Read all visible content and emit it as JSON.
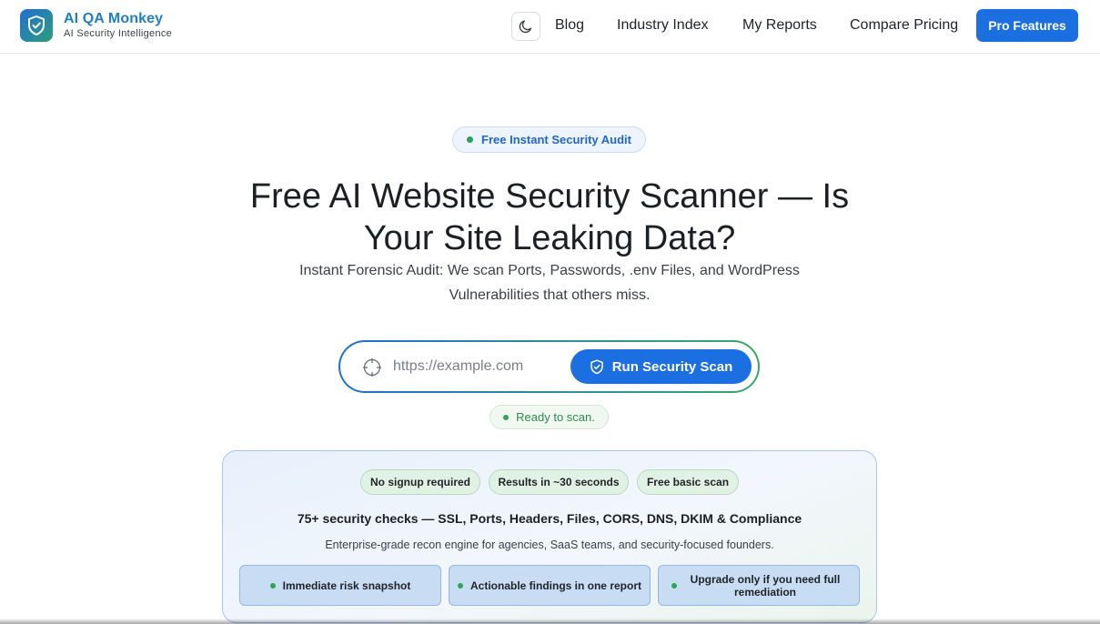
{
  "brand": {
    "name": "AI QA Monkey",
    "tagline": "AI Security Intelligence",
    "colors": {
      "primary": "#1b6fe0",
      "accent_green": "#2fa35a"
    }
  },
  "header": {
    "theme_toggle_icon": "moon-icon",
    "nav": [
      "Blog",
      "Industry Index",
      "My Reports",
      "Compare Pricing"
    ],
    "cta_label": "Pro Features"
  },
  "hero": {
    "badge": "Free Instant Security Audit",
    "title": "Free AI Website Security Scanner — Is Your Site Leaking Data?",
    "subtitle": "Instant Forensic Audit: We scan Ports, Passwords, .env Files, and WordPress Vulnerabilities that others miss."
  },
  "scan": {
    "placeholder": "https://example.com",
    "button_label": "Run Security Scan",
    "status": "Ready to scan."
  },
  "card": {
    "chips": [
      "No signup required",
      "Results in ~30 seconds",
      "Free basic scan"
    ],
    "title": "75+ security checks — SSL, Ports, Headers, Files, CORS, DNS, DKIM & Compliance",
    "description": "Enterprise-grade recon engine for agencies, SaaS teams, and security-focused founders.",
    "features": [
      "Immediate risk snapshot",
      "Actionable findings in one report",
      "Upgrade only if you need full remediation"
    ]
  }
}
